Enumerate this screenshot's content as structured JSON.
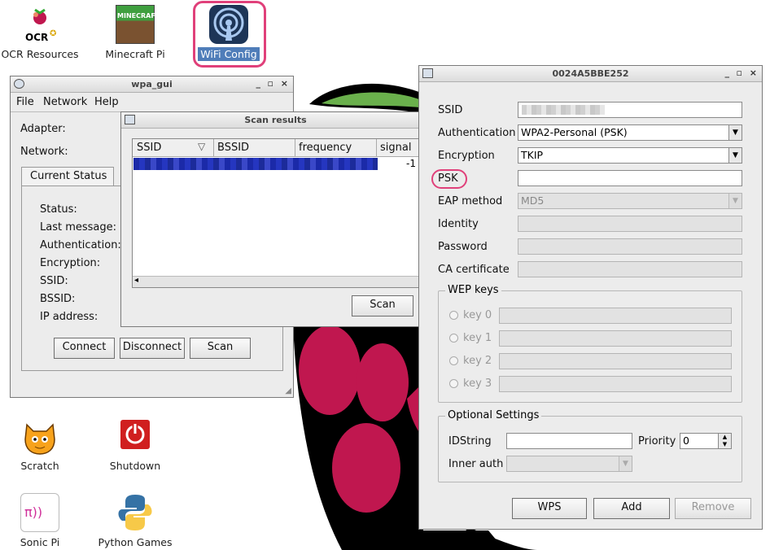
{
  "desktop": {
    "icons": [
      {
        "label": "OCR Resources",
        "icon": "raspberry-ocr-icon"
      },
      {
        "label": "Minecraft Pi",
        "icon": "minecraft-icon"
      },
      {
        "label": "WiFi Config",
        "icon": "wifi-icon",
        "selected": true
      },
      {
        "label": "Scratch",
        "icon": "scratch-cat-icon"
      },
      {
        "label": "Shutdown",
        "icon": "power-icon"
      },
      {
        "label": "Sonic Pi",
        "icon": "sonic-pi-icon"
      },
      {
        "label": "Python Games",
        "icon": "python-icon"
      }
    ],
    "ocr_logo_text": "OCR",
    "sonic_logo_text": "π))",
    "minecraft_logo_text": "MINECRAFT"
  },
  "wpa_gui": {
    "title": "wpa_gui",
    "menu": [
      "File",
      "Network",
      "Help"
    ],
    "adapter_label": "Adapter:",
    "network_label": "Network:",
    "tab_label": "Current Status",
    "status_fields": [
      "Status:",
      "Last message:",
      "Authentication:",
      "Encryption:",
      "SSID:",
      "BSSID:",
      "IP address:"
    ],
    "buttons": {
      "connect": "Connect",
      "disconnect": "Disconnect",
      "scan": "Scan"
    }
  },
  "scan_results": {
    "title": "Scan results",
    "columns": [
      "SSID",
      "BSSID",
      "frequency",
      "signal"
    ],
    "row_signal_partial": "-1",
    "scan_button": "Scan"
  },
  "network_dialog": {
    "title": "0024A5BBE252",
    "labels": {
      "ssid": "SSID",
      "authentication": "Authentication",
      "encryption": "Encryption",
      "psk": "PSK",
      "eap_method": "EAP method",
      "identity": "Identity",
      "password": "Password",
      "ca_certificate": "CA certificate"
    },
    "values": {
      "authentication": "WPA2-Personal (PSK)",
      "encryption": "TKIP",
      "psk": "",
      "eap_method": "MD5"
    },
    "wep_keys": {
      "title": "WEP keys",
      "keys": [
        "key 0",
        "key 1",
        "key 2",
        "key 3"
      ]
    },
    "optional": {
      "title": "Optional Settings",
      "idstring_label": "IDString",
      "priority_label": "Priority",
      "priority_value": "0",
      "inner_auth_label": "Inner auth"
    },
    "buttons": {
      "wps": "WPS",
      "add": "Add",
      "remove": "Remove"
    }
  },
  "colors": {
    "highlight_ring": "#e0407a",
    "selection": "#4f7db9",
    "raspberry": "#c0174f",
    "leaf": "#6ab04c"
  }
}
